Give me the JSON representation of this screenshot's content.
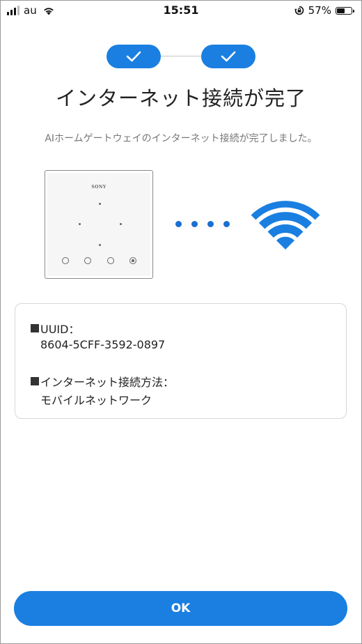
{
  "status_bar": {
    "carrier": "au",
    "time": "15:51",
    "battery_percent": "57%",
    "battery_level": 0.57,
    "icons": [
      "signal-icon",
      "wifi-icon",
      "rotation-lock-icon",
      "battery-icon"
    ]
  },
  "stepper": {
    "steps": [
      {
        "state": "completed",
        "icon": "checkmark-icon"
      },
      {
        "state": "completed",
        "icon": "checkmark-icon"
      }
    ],
    "accent_color": "#1a7fe0"
  },
  "page": {
    "title": "インターネット接続が完了",
    "description": "AIホームゲートウェイのインターネット接続が完了しました。"
  },
  "illustration": {
    "device_brand": "SONY",
    "connection_icon": "wifi-icon",
    "dot_color": "#1a6fd0"
  },
  "info": {
    "uuid_label": "UUID：",
    "uuid_value": "8604-5CFF-3592-0897",
    "method_label": "インターネット接続方法：",
    "method_value": "モバイルネットワーク"
  },
  "actions": {
    "ok_label": "OK"
  }
}
